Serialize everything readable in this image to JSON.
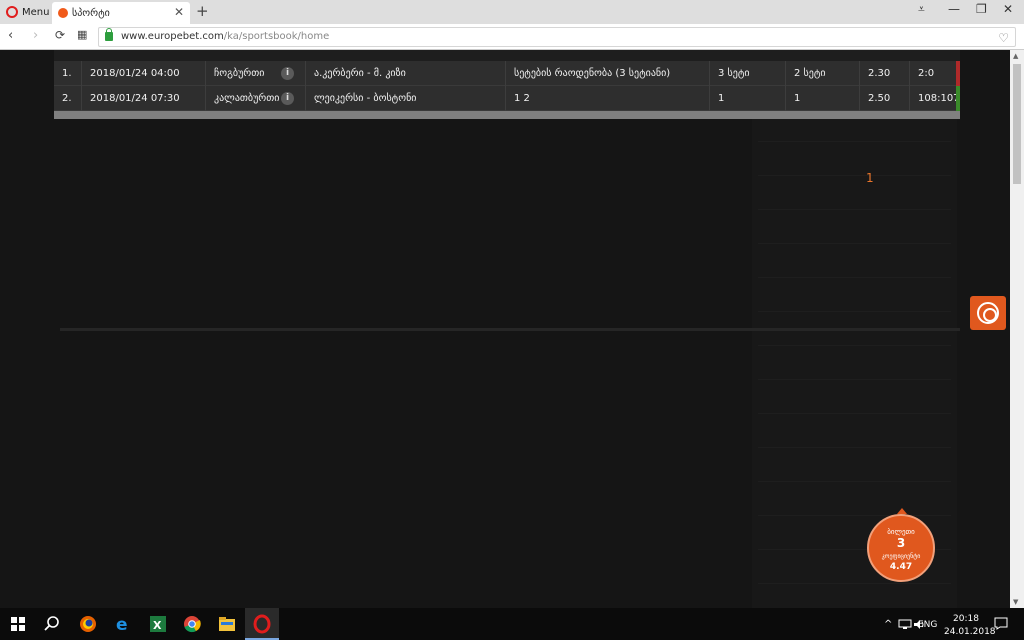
{
  "browser": {
    "menu_label": "Menu",
    "tab_title": "სპორტი",
    "url_domain": "www.europebet.com",
    "url_path": "/ka/sportsbook/home"
  },
  "table": {
    "rows": [
      {
        "num": "1.",
        "date": "2018/01/24 04:00",
        "sport": "ჩოგბურთი",
        "event": "ა.კერბერი - მ. კიზი",
        "market": "სეტების რაოდენობა (3 სეტიანი)",
        "pick": "3 სეტი",
        "result": "2 სეტი",
        "odds": "2.30",
        "score": "2:0",
        "status_color": "#b02a2a"
      },
      {
        "num": "2.",
        "date": "2018/01/24 07:30",
        "sport": "კალათბურთი",
        "event": "ლეიკერსი - ბოსტონი",
        "market": "1 2",
        "pick": "1",
        "result": "1",
        "odds": "2.50",
        "score": "108:107",
        "status_color": "#3a8a2a"
      }
    ],
    "page_number": "1"
  },
  "betslip": {
    "title": "ბილეთი",
    "count": "3",
    "label": "კოეფიციენტი",
    "odds": "4.47"
  },
  "taskbar": {
    "lang": "ENG",
    "time": "20:18",
    "date": "24.01.2018",
    "tray_chevron": "^"
  },
  "icons": [
    "windows-logo-icon",
    "search-icon",
    "firefox-icon",
    "edge-icon",
    "excel-icon",
    "chrome-icon",
    "file-explorer-icon",
    "opera-icon",
    "network-icon",
    "volume-icon",
    "notifications-icon"
  ]
}
